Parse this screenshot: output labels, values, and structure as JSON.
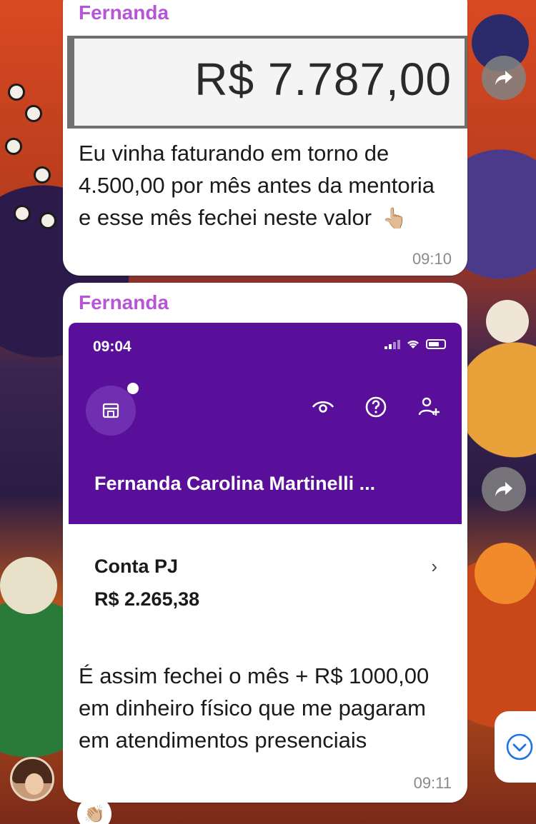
{
  "messages": [
    {
      "sender": "Fernanda",
      "image_amount": "R$ 7.787,00",
      "text": "Eu vinha faturando em torno de 4.500,00 por mês antes da mentoria e esse mês fechei neste valor",
      "emoji": "👆🏼",
      "time": "09:10"
    },
    {
      "sender": "Fernanda",
      "app": {
        "status_time": "09:04",
        "account_name": "Fernanda Carolina Martinelli ...",
        "account_label": "Conta PJ",
        "balance": "R$ 2.265,38"
      },
      "text": "É assim fechei o mês + R$ 1000,00 em dinheiro físico que me pagaram em atendimentos presenciais",
      "time": "09:11",
      "reaction": "👏🏼"
    }
  ],
  "colors": {
    "sender": "#b655d6",
    "app_purple": "#5a0f9a"
  }
}
